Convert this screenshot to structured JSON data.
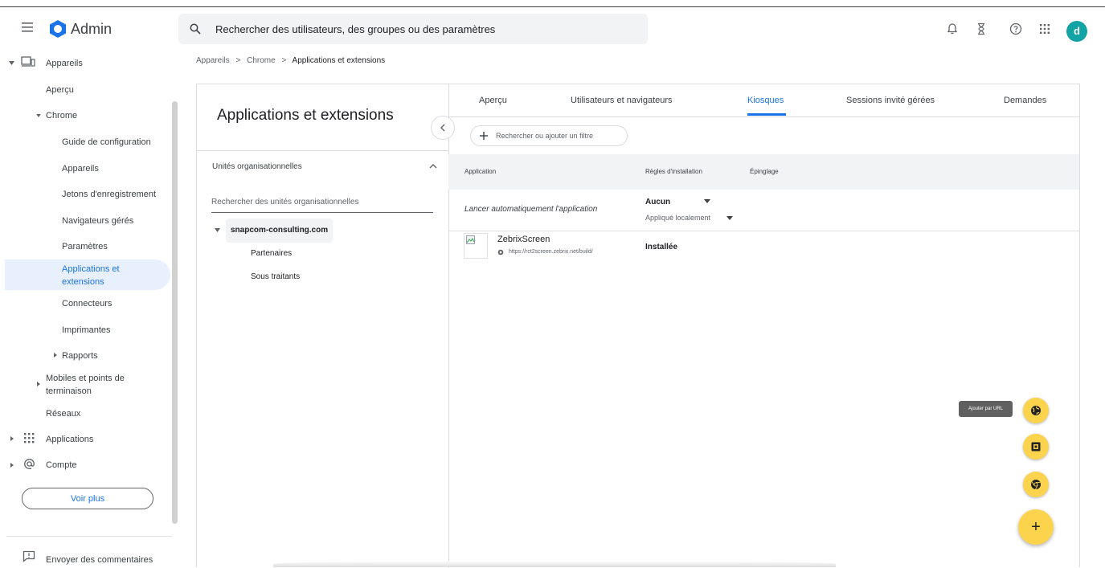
{
  "header": {
    "app_title": "Admin",
    "search_placeholder": "Rechercher des utilisateurs, des groupes ou des paramètres",
    "avatar_letter": "d"
  },
  "sidebar": {
    "items": [
      {
        "label": "Appareils"
      },
      {
        "label": "Aperçu"
      },
      {
        "label": "Chrome"
      },
      {
        "label": "Guide de configuration"
      },
      {
        "label": "Appareils"
      },
      {
        "label": "Jetons d'enregistrement"
      },
      {
        "label": "Navigateurs gérés"
      },
      {
        "label": "Paramètres"
      },
      {
        "label": "Applications et"
      },
      {
        "label": "extensions"
      },
      {
        "label": "Connecteurs"
      },
      {
        "label": "Imprimantes"
      },
      {
        "label": "Rapports"
      },
      {
        "label": "Mobiles et points de"
      },
      {
        "label": "terminaison"
      },
      {
        "label": "Réseaux"
      },
      {
        "label": "Applications"
      },
      {
        "label": "Compte"
      }
    ],
    "voir_plus": "Voir plus",
    "feedback": "Envoyer des commentaires"
  },
  "breadcrumb": {
    "part1": "Appareils",
    "part2": "Chrome",
    "current": "Applications et extensions",
    "sep": ">"
  },
  "left_panel": {
    "title": "Applications et extensions",
    "ou_label": "Unités organisationnelles",
    "ou_search_placeholder": "Rechercher des unités organisationnelles",
    "ou_root": "snapcom-consulting.com",
    "ou_children": [
      "Partenaires",
      "Sous traitants"
    ]
  },
  "tabs": [
    {
      "label": "Aperçu"
    },
    {
      "label": "Utilisateurs et navigateurs"
    },
    {
      "label": "Kiosques"
    },
    {
      "label": "Sessions invité gérées"
    },
    {
      "label": "Demandes"
    }
  ],
  "filter": {
    "placeholder": "Rechercher ou ajouter un filtre"
  },
  "table": {
    "headers": [
      "Application",
      "Règles d'installation",
      "Épinglage"
    ],
    "launch_label": "Lancer automatiquement l'application",
    "launch_value": "Aucun",
    "launch_sub": "Appliqué localement",
    "app": {
      "name": "ZebrixScreen",
      "url": "https://rct2screen.zebrix.net/build/",
      "status": "Installée"
    }
  },
  "fab": {
    "tooltip": "Ajouter par URL",
    "main": "+"
  },
  "colors": {
    "accent": "#1a73e8",
    "fab": "#fcd34d",
    "active_bg": "#e8f0fe",
    "avatar": "#12a4a4"
  }
}
